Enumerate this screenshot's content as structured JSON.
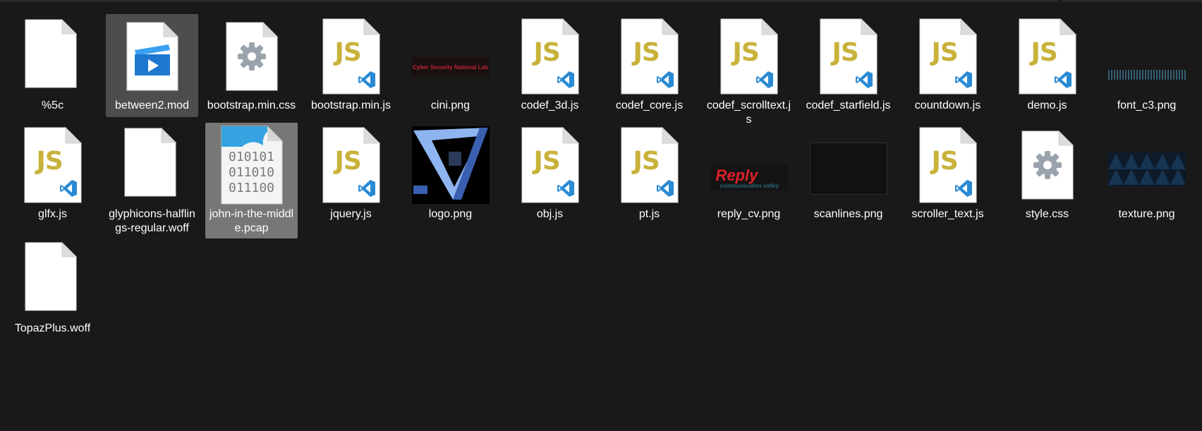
{
  "files": [
    {
      "name": "%5c",
      "icon": "blank-file-icon"
    },
    {
      "name": "between2.mod",
      "icon": "media-file-icon",
      "state": "hover"
    },
    {
      "name": "bootstrap.min.css",
      "icon": "settings-file-icon"
    },
    {
      "name": "bootstrap.min.js",
      "icon": "js-file-icon"
    },
    {
      "name": "cini.png",
      "icon": "image-thumbnail",
      "thumb_text": "Cyber Security National Lab"
    },
    {
      "name": "codef_3d.js",
      "icon": "js-file-icon"
    },
    {
      "name": "codef_core.js",
      "icon": "js-file-icon"
    },
    {
      "name": "codef_scrolltext.js",
      "icon": "js-file-icon"
    },
    {
      "name": "codef_starfield.js",
      "icon": "js-file-icon"
    },
    {
      "name": "countdown.js",
      "icon": "js-file-icon"
    },
    {
      "name": "demo.js",
      "icon": "js-file-icon"
    },
    {
      "name": "font_c3.png",
      "icon": "image-thumbnail"
    },
    {
      "name": "glfx.js",
      "icon": "js-file-icon"
    },
    {
      "name": "glyphicons-halflings-regular.woff",
      "icon": "blank-file-icon"
    },
    {
      "name": "john-in-the-middle.pcap",
      "icon": "binary-file-icon",
      "state": "selected",
      "binary_lines": [
        "010101",
        "011010",
        "011100"
      ]
    },
    {
      "name": "jquery.js",
      "icon": "js-file-icon"
    },
    {
      "name": "logo.png",
      "icon": "image-thumbnail"
    },
    {
      "name": "obj.js",
      "icon": "js-file-icon"
    },
    {
      "name": "pt.js",
      "icon": "js-file-icon"
    },
    {
      "name": "reply_cv.png",
      "icon": "image-thumbnail",
      "thumb_text": "Reply",
      "thumb_subtext": "communication valley"
    },
    {
      "name": "scanlines.png",
      "icon": "image-thumbnail"
    },
    {
      "name": "scroller_text.js",
      "icon": "js-file-icon"
    },
    {
      "name": "style.css",
      "icon": "settings-file-icon"
    },
    {
      "name": "texture.png",
      "icon": "image-thumbnail"
    },
    {
      "name": "TopazPlus.woff",
      "icon": "blank-file-icon"
    }
  ],
  "js_badge": "JS",
  "colors": {
    "background": "#191919",
    "hover": "#4d4d4d",
    "selected": "#777777",
    "js_yellow": "#c8b23a",
    "vscode_blue": "#2a8ad4"
  }
}
